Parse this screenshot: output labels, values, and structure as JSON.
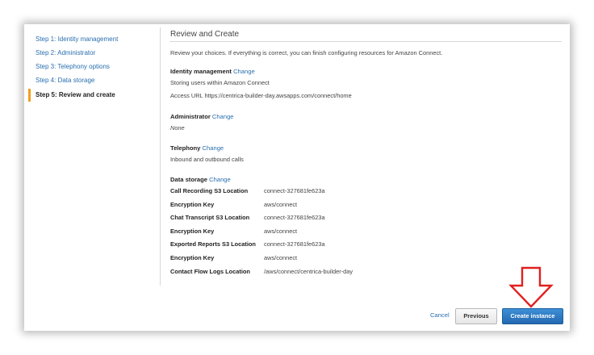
{
  "sidebar": {
    "steps": [
      {
        "label": "Step 1: Identity management"
      },
      {
        "label": "Step 2: Administrator"
      },
      {
        "label": "Step 3: Telephony options"
      },
      {
        "label": "Step 4: Data storage"
      },
      {
        "label": "Step 5: Review and create"
      }
    ]
  },
  "main": {
    "title": "Review and Create",
    "intro": "Review your choices. If everything is correct, you can finish configuring resources for Amazon Connect.",
    "change_label": "Change",
    "identity": {
      "heading": "Identity management",
      "line1": "Storing users within Amazon Connect",
      "line2": "Access URL  https://centrica-builder-day.awsapps.com/connect/home"
    },
    "administrator": {
      "heading": "Administrator",
      "value": "None"
    },
    "telephony": {
      "heading": "Telephony",
      "value": "Inbound and outbound calls"
    },
    "data_storage": {
      "heading": "Data storage",
      "rows": [
        {
          "key": "Call Recording S3 Location",
          "value": "connect-327681fe623a"
        },
        {
          "key": "Encryption Key",
          "value": "aws/connect"
        },
        {
          "key": "Chat Transcript S3 Location",
          "value": "connect-327681fe623a"
        },
        {
          "key": "Encryption Key",
          "value": "aws/connect"
        },
        {
          "key": "Exported Reports S3 Location",
          "value": "connect-327681fe623a"
        },
        {
          "key": "Encryption Key",
          "value": "aws/connect"
        },
        {
          "key": "Contact Flow Logs Location",
          "value": "/aws/connect/centrica-builder-day"
        }
      ]
    }
  },
  "footer": {
    "cancel_label": "Cancel",
    "previous_label": "Previous",
    "create_label": "Create instance"
  },
  "colors": {
    "link": "#2a6fb0",
    "primary_button": "#2468b0",
    "active_step_marker": "#f0a020",
    "annotation_arrow": "#e02020"
  },
  "icons": {
    "annotation": "down-arrow-outline-icon"
  }
}
